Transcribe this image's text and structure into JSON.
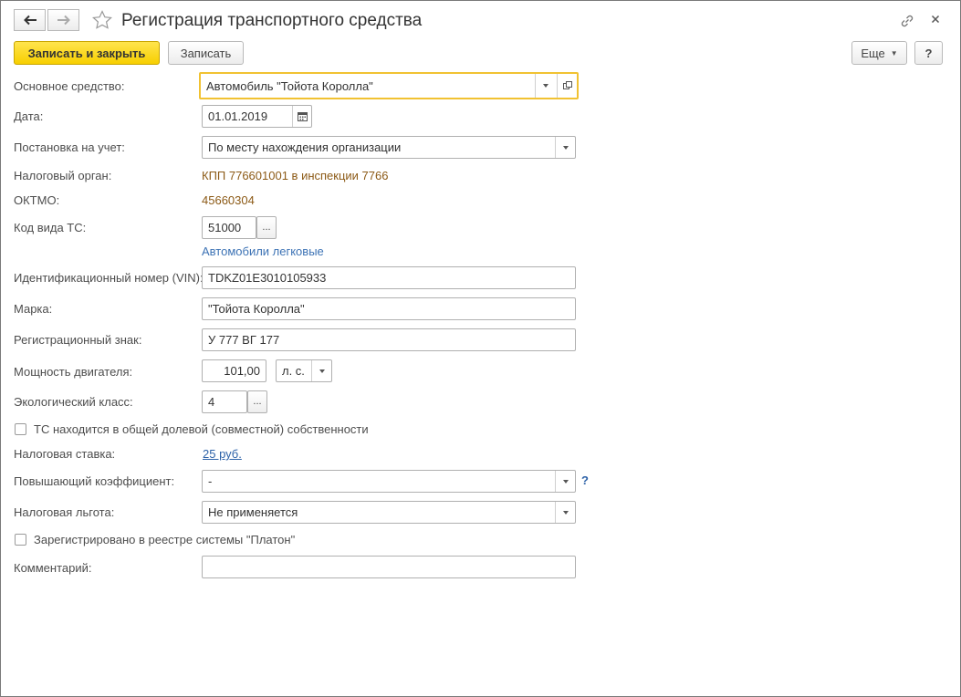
{
  "window": {
    "title": "Регистрация транспортного средства"
  },
  "toolbar": {
    "save_close_label": "Записать и закрыть",
    "save_label": "Записать",
    "more_label": "Еще",
    "help_label": "?"
  },
  "form": {
    "asset": {
      "label": "Основное средство:",
      "value": "Автомобиль \"Тойота Королла\""
    },
    "date": {
      "label": "Дата:",
      "value": "01.01.2019"
    },
    "registration": {
      "label": "Постановка на учет:",
      "value": "По месту нахождения организации"
    },
    "tax_authority": {
      "label": "Налоговый орган:",
      "value": "КПП 776601001 в инспекции 7766"
    },
    "oktmo": {
      "label": "ОКТМО:",
      "value": "45660304"
    },
    "vehicle_code": {
      "label": "Код вида ТС:",
      "value": "51000",
      "dots": "...",
      "description": "Автомобили легковые"
    },
    "vin": {
      "label": "Идентификационный номер (VIN):",
      "value": "TDKZ01E3010105933"
    },
    "brand": {
      "label": "Марка:",
      "value": "\"Тойота Королла\""
    },
    "reg_sign": {
      "label": "Регистрационный знак:",
      "value": "У 777 ВГ 177"
    },
    "power": {
      "label": "Мощность двигателя:",
      "value": "101,00",
      "unit": "л. с."
    },
    "eco_class": {
      "label": "Экологический класс:",
      "value": "4",
      "dots": "..."
    },
    "shared_ownership": {
      "label": "ТС находится в общей долевой (совместной) собственности",
      "checked": false
    },
    "tax_rate": {
      "label": "Налоговая ставка:",
      "value": "25 руб."
    },
    "coefficient": {
      "label": "Повышающий коэффициент:",
      "value": "-",
      "help": "?"
    },
    "benefit": {
      "label": "Налоговая льгота:",
      "value": "Не применяется"
    },
    "platon": {
      "label": "Зарегистрировано в реестре системы \"Платон\"",
      "checked": false
    },
    "comment": {
      "label": "Комментарий:",
      "value": ""
    }
  },
  "colors": {
    "primary_button": "#f7cf00",
    "focus_border": "#f1c232",
    "static_value": "#8c5a16",
    "link": "#3d73b5"
  }
}
